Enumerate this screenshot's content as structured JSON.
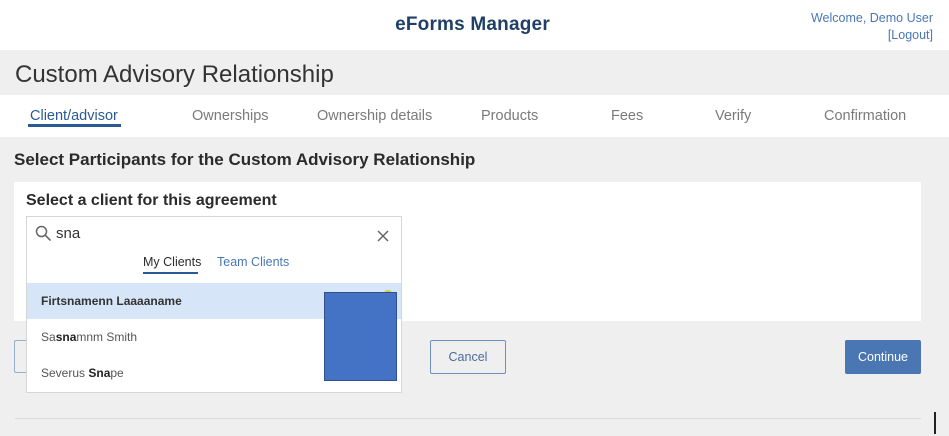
{
  "header": {
    "app_title": "eForms Manager",
    "welcome_text": "Welcome, Demo User",
    "logout_label": "[Logout]"
  },
  "page": {
    "title": "Custom Advisory Relationship"
  },
  "steps": [
    {
      "label": "Client/advisor",
      "active": true
    },
    {
      "label": "Ownerships",
      "active": false
    },
    {
      "label": "Ownership details",
      "active": false
    },
    {
      "label": "Products",
      "active": false
    },
    {
      "label": "Fees",
      "active": false
    },
    {
      "label": "Verify",
      "active": false
    },
    {
      "label": "Confirmation",
      "active": false
    }
  ],
  "section": {
    "title": "Select Participants for the Custom Advisory Relationship",
    "panel_title": "Select a client for this agreement"
  },
  "search": {
    "value": "sna",
    "sub_tabs": [
      {
        "label": "My Clients",
        "active": true
      },
      {
        "label": "Team Clients",
        "active": false
      }
    ],
    "results": [
      {
        "parts": [
          "Firt",
          "sna",
          "menn Laaaaname"
        ],
        "highlighted": true
      },
      {
        "parts": [
          "Sa",
          "sna",
          "mnm Smith"
        ],
        "highlighted": false
      },
      {
        "parts": [
          "Severus ",
          "Sna",
          "pe"
        ],
        "highlighted": false
      }
    ]
  },
  "buttons": {
    "cancel": "Cancel",
    "continue": "Continue"
  },
  "colors": {
    "accent": "#2a5a94",
    "link": "#4a77b4",
    "highlight_row": "#d6e6f8",
    "overlay": "#4472c4"
  }
}
